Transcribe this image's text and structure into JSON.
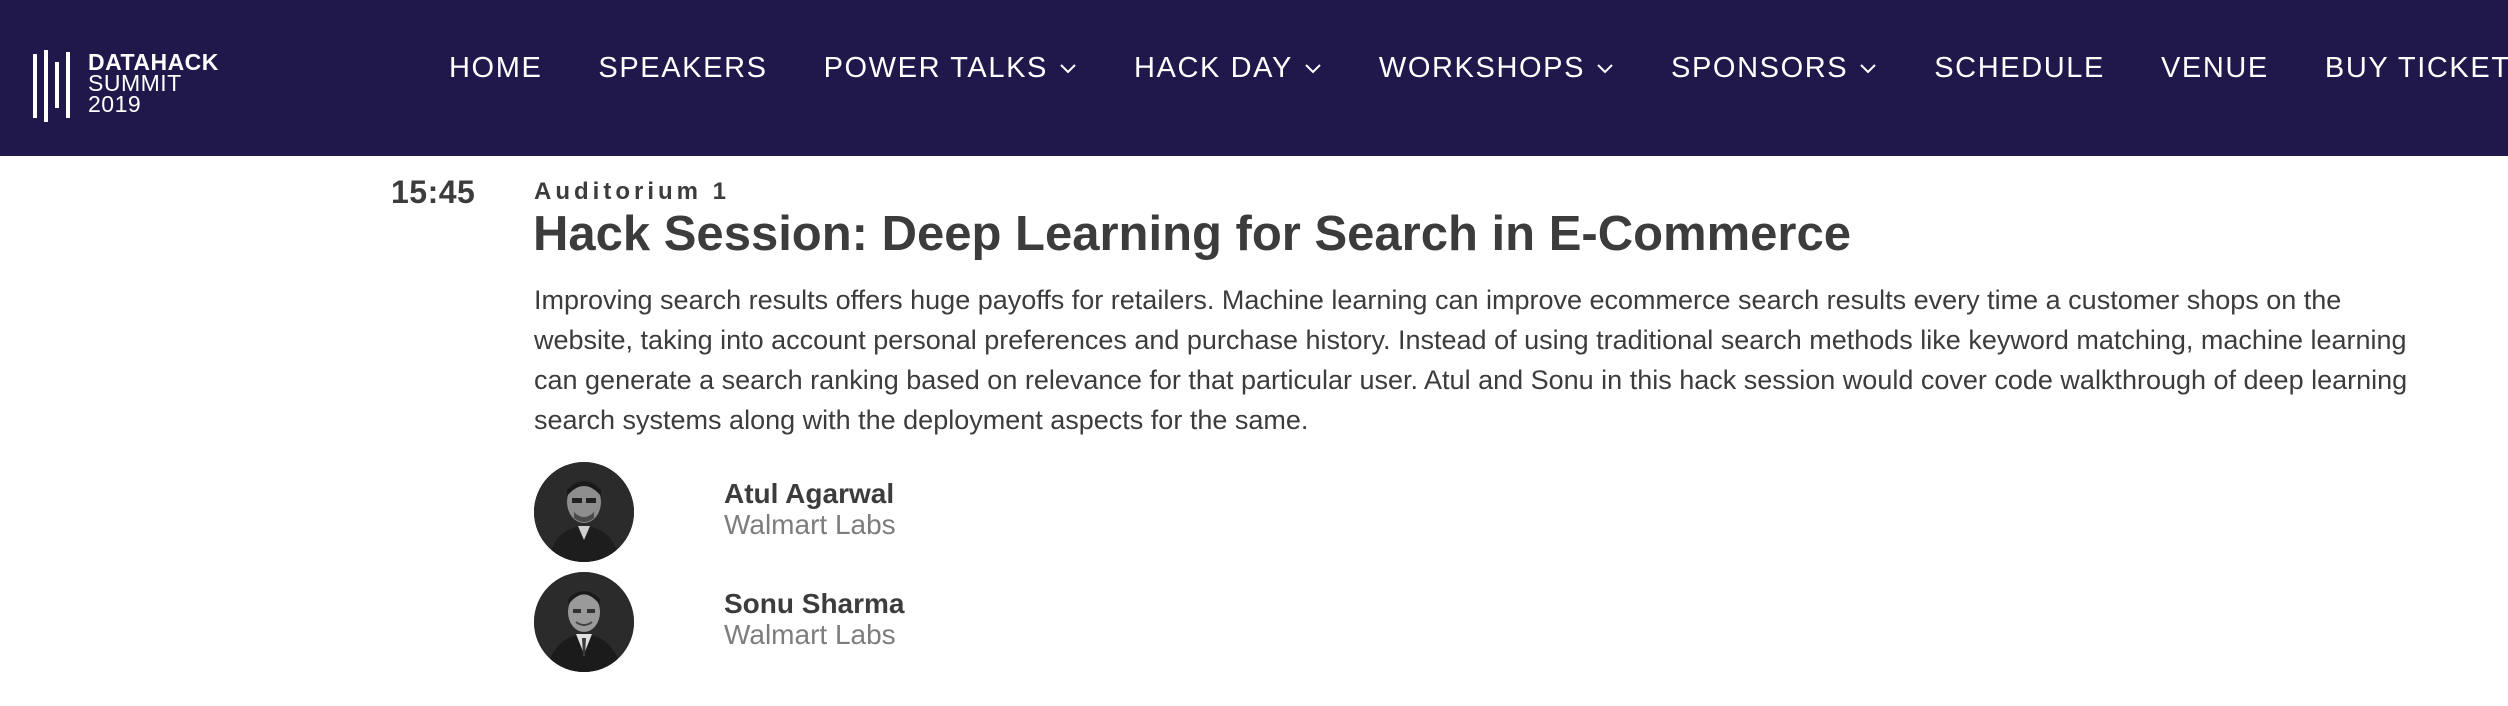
{
  "brand": {
    "line1": "DATAHACK",
    "line2": "SUMMIT",
    "line3": "2019",
    "icon": "datahack-logo-mark"
  },
  "nav": {
    "items": [
      {
        "label": "HOME",
        "has_dropdown": false
      },
      {
        "label": "SPEAKERS",
        "has_dropdown": false
      },
      {
        "label": "POWER TALKS",
        "has_dropdown": true
      },
      {
        "label": "HACK DAY",
        "has_dropdown": true
      },
      {
        "label": "WORKSHOPS",
        "has_dropdown": true
      },
      {
        "label": "SPONSORS",
        "has_dropdown": true
      },
      {
        "label": "SCHEDULE",
        "has_dropdown": false
      },
      {
        "label": "VENUE",
        "has_dropdown": false
      },
      {
        "label": "BUY TICKETS",
        "has_dropdown": false
      }
    ]
  },
  "session": {
    "time": "15:45",
    "room": "Auditorium 1",
    "title": "Hack Session: Deep Learning for Search in E-Commerce",
    "description": "Improving search results offers huge payoffs for retailers. Machine learning can improve ecommerce search results every time a customer shops on the website, taking into account personal preferences and purchase history. Instead of using traditional search methods like keyword matching, machine learning can generate a search ranking based on relevance for that particular user. Atul and Sonu in this hack session would cover code walkthrough of deep learning search systems along with the deployment aspects for the same.",
    "speakers": [
      {
        "name": "Atul Agarwal",
        "org": "Walmart Labs"
      },
      {
        "name": "Sonu Sharma",
        "org": "Walmart Labs"
      }
    ]
  },
  "colors": {
    "nav_background": "#20184a",
    "nav_text": "#ffffff",
    "body_text": "#3c3c3c",
    "muted_text": "#7d7d7d"
  }
}
